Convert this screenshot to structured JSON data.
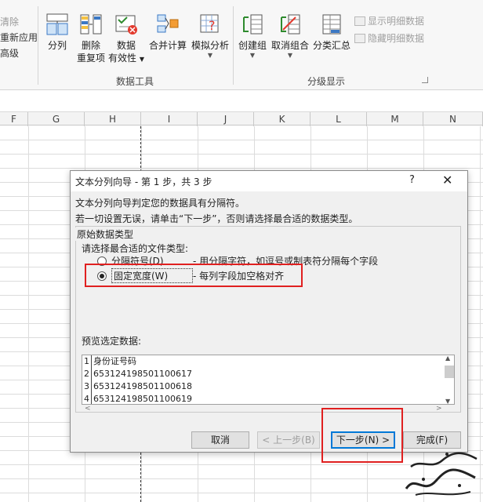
{
  "ribbon": {
    "cutoff_lines": [
      "清除",
      "重新应用",
      "高级"
    ],
    "buttons": {
      "split": "分列",
      "remove_dup_1": "删除",
      "remove_dup_2": "重复项",
      "validation_1": "数据",
      "validation_2": "有效性",
      "consolidate": "合并计算",
      "whatif": "模拟分析",
      "group": "创建组",
      "ungroup": "取消组合",
      "subtotal": "分类汇总"
    },
    "small": {
      "show_detail": "显示明细数据",
      "hide_detail": "隐藏明细数据"
    },
    "groups": {
      "data_tools": "数据工具",
      "outline": "分级显示"
    }
  },
  "sheet": {
    "columns": [
      "F",
      "G",
      "H",
      "I",
      "J",
      "K",
      "L",
      "M",
      "N"
    ]
  },
  "dialog": {
    "title": "文本分列向导 - 第 1 步，共 3 步",
    "help": "?",
    "close": "✕",
    "line1": "文本分列向导判定您的数据具有分隔符。",
    "line2": "若一切设置无误，请单击“下一步”，否则请选择最合适的数据类型。",
    "legend": "原始数据类型",
    "prompt": "请选择最合适的文件类型:",
    "option_delimited": "分隔符号(D)",
    "option_delimited_desc": " - 用分隔字符，如逗号或制表符分隔每个字段",
    "option_fixed": "固定宽度(W)",
    "option_fixed_desc": " - 每列字段加空格对齐",
    "preview_label": "预览选定数据:",
    "preview_rows": [
      {
        "num": "1",
        "text": "身份证号码"
      },
      {
        "num": "2",
        "text": "653124198501100617"
      },
      {
        "num": "3",
        "text": "653124198501100618"
      },
      {
        "num": "4",
        "text": "653124198501100619"
      }
    ],
    "buttons": {
      "cancel": "取消",
      "back": "< 上一步(B)",
      "next": "下一步(N) >",
      "finish": "完成(F)"
    }
  }
}
